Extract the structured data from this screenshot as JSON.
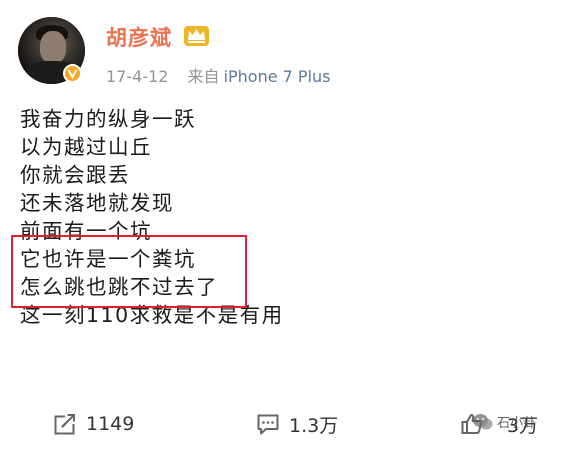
{
  "user": {
    "name": "胡彦斌",
    "time": "17-4-12",
    "source_prefix": "来自",
    "source": "iPhone 7 Plus"
  },
  "post": {
    "lines": [
      "我奋力的纵身一跃",
      "以为越过山丘",
      "你就会跟丢",
      "还未落地就发现",
      "前面有一个坑",
      "它也许是一个粪坑",
      "怎么跳也跳不过去了",
      "这一刻110求救是不是有用"
    ]
  },
  "actions": {
    "repost_count": "1149",
    "comment_count": "1.3万",
    "like_count": "3万"
  },
  "watermark": {
    "text": "石小卦"
  },
  "colors": {
    "username": "#eb7350",
    "highlight_border": "#e0202a",
    "source_link": "#5b7b9e"
  }
}
